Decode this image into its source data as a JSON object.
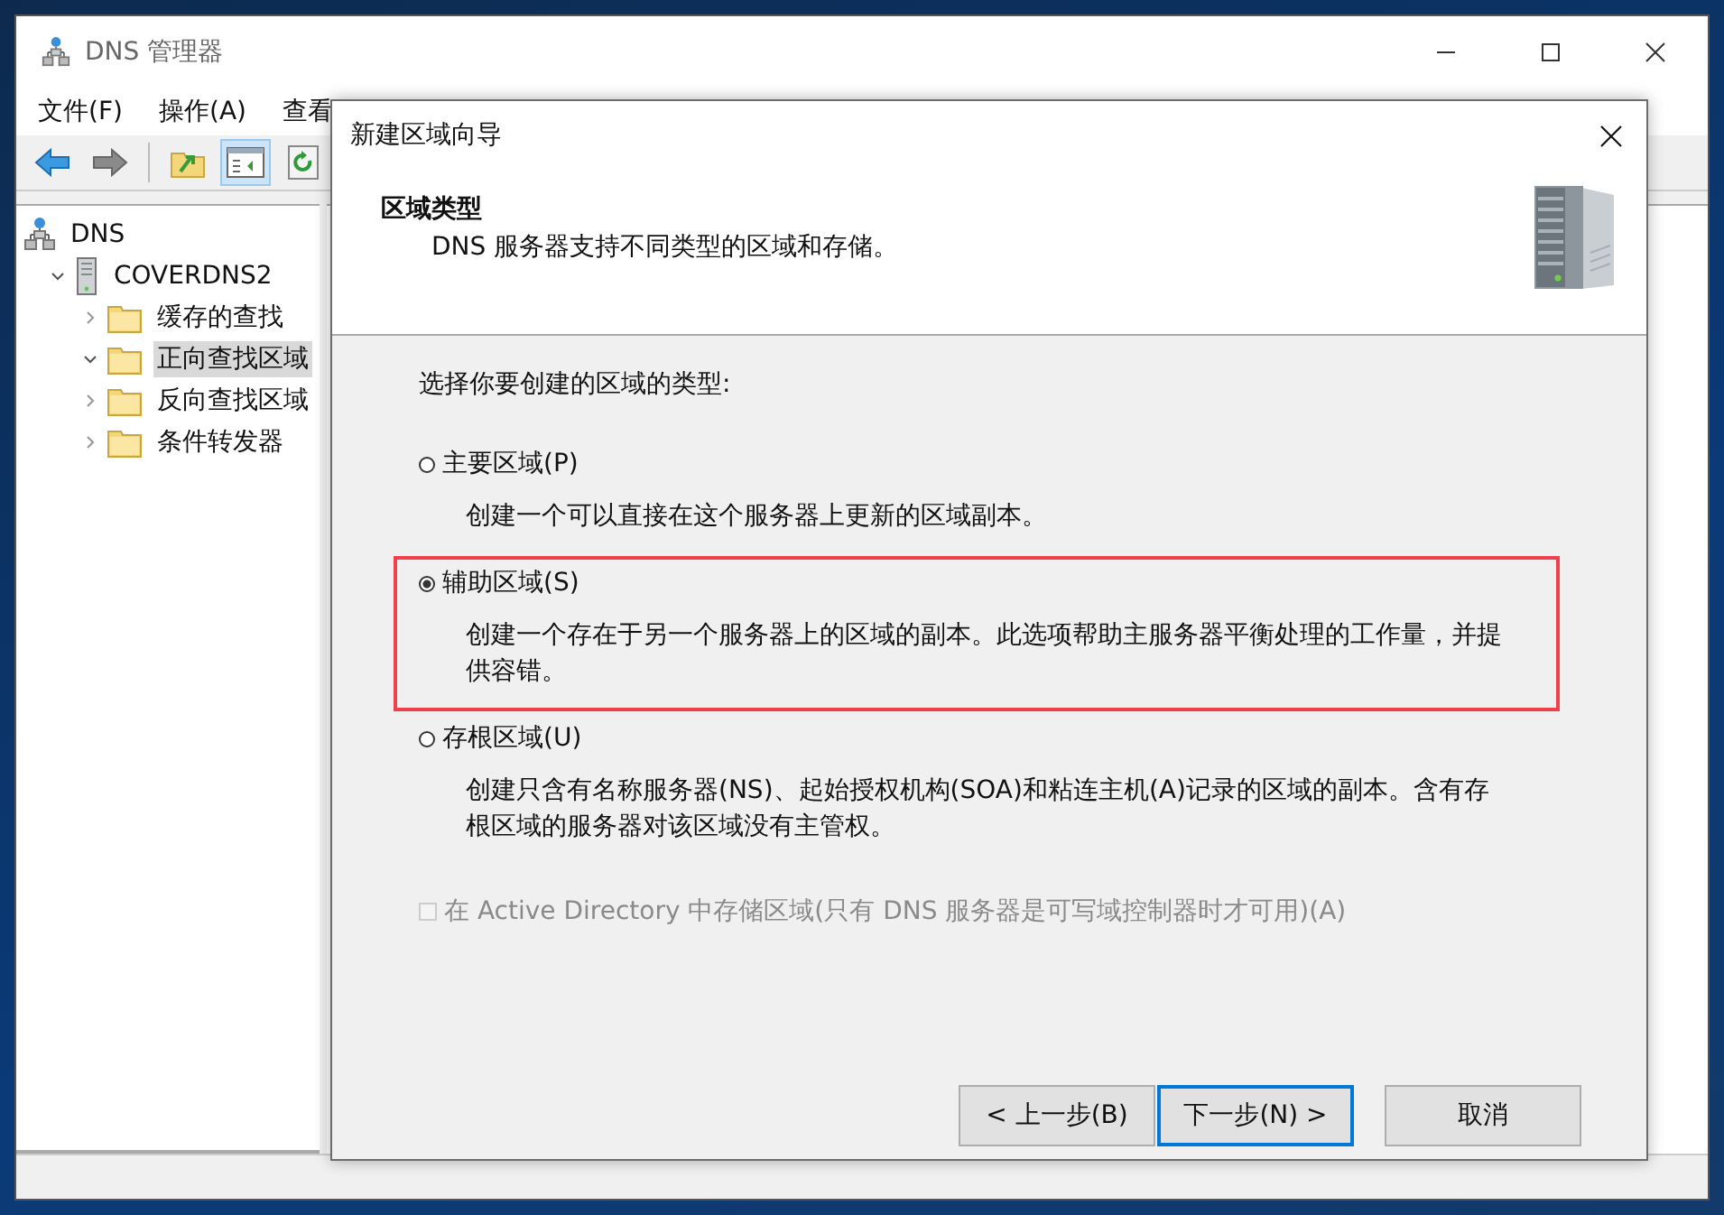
{
  "window": {
    "title": "DNS 管理器"
  },
  "menu": [
    "文件(F)",
    "操作(A)",
    "查看"
  ],
  "toolbar": [
    {
      "kind": "back",
      "selected": false
    },
    {
      "kind": "forward",
      "selected": false
    },
    {
      "kind": "up",
      "selected": false
    },
    {
      "kind": "tree",
      "selected": true
    },
    {
      "kind": "refresh",
      "selected": false
    }
  ],
  "tree": [
    {
      "label": "DNS",
      "kind": "dns",
      "selected": false,
      "children": [
        {
          "label": "COVERDNS2",
          "kind": "server",
          "expanded": true,
          "selected": false,
          "children": [
            {
              "label": "缓存的查找",
              "kind": "folder",
              "expanded": false,
              "selected": false
            },
            {
              "label": "正向查找区域",
              "kind": "folder",
              "expanded": true,
              "selected": true
            },
            {
              "label": "反向查找区域",
              "kind": "folder",
              "expanded": false,
              "selected": false
            },
            {
              "label": "条件转发器",
              "kind": "folder",
              "expanded": false,
              "selected": false
            }
          ]
        }
      ]
    }
  ],
  "dialog": {
    "title": "新建区域向导",
    "heading": "区域类型",
    "subtitle": "DNS 服务器支持不同类型的区域和存储。",
    "prompt": "选择你要创建的区域的类型:",
    "options": [
      {
        "label": "主要区域(P)",
        "description": "创建一个可以直接在这个服务器上更新的区域副本。",
        "selected": false,
        "highlighted": false
      },
      {
        "label": "辅助区域(S)",
        "description": "创建一个存在于另一个服务器上的区域的副本。此选项帮助主服务器平衡处理的工作量，并提供容错。",
        "selected": true,
        "highlighted": true
      },
      {
        "label": "存根区域(U)",
        "description": "创建只含有名称服务器(NS)、起始授权机构(SOA)和粘连主机(A)记录的区域的副本。含有存根区域的服务器对该区域没有主管权。",
        "selected": false,
        "highlighted": false
      }
    ],
    "ad_option": {
      "label": "在 Active Directory 中存储区域(只有 DNS 服务器是可写域控制器时才可用)(A)",
      "checked": false,
      "disabled": true
    },
    "buttons": [
      {
        "label": "< 上一步(B)",
        "focused": false
      },
      {
        "label": "下一步(N) >",
        "focused": true
      },
      {
        "label": "取消",
        "focused": false
      }
    ]
  }
}
